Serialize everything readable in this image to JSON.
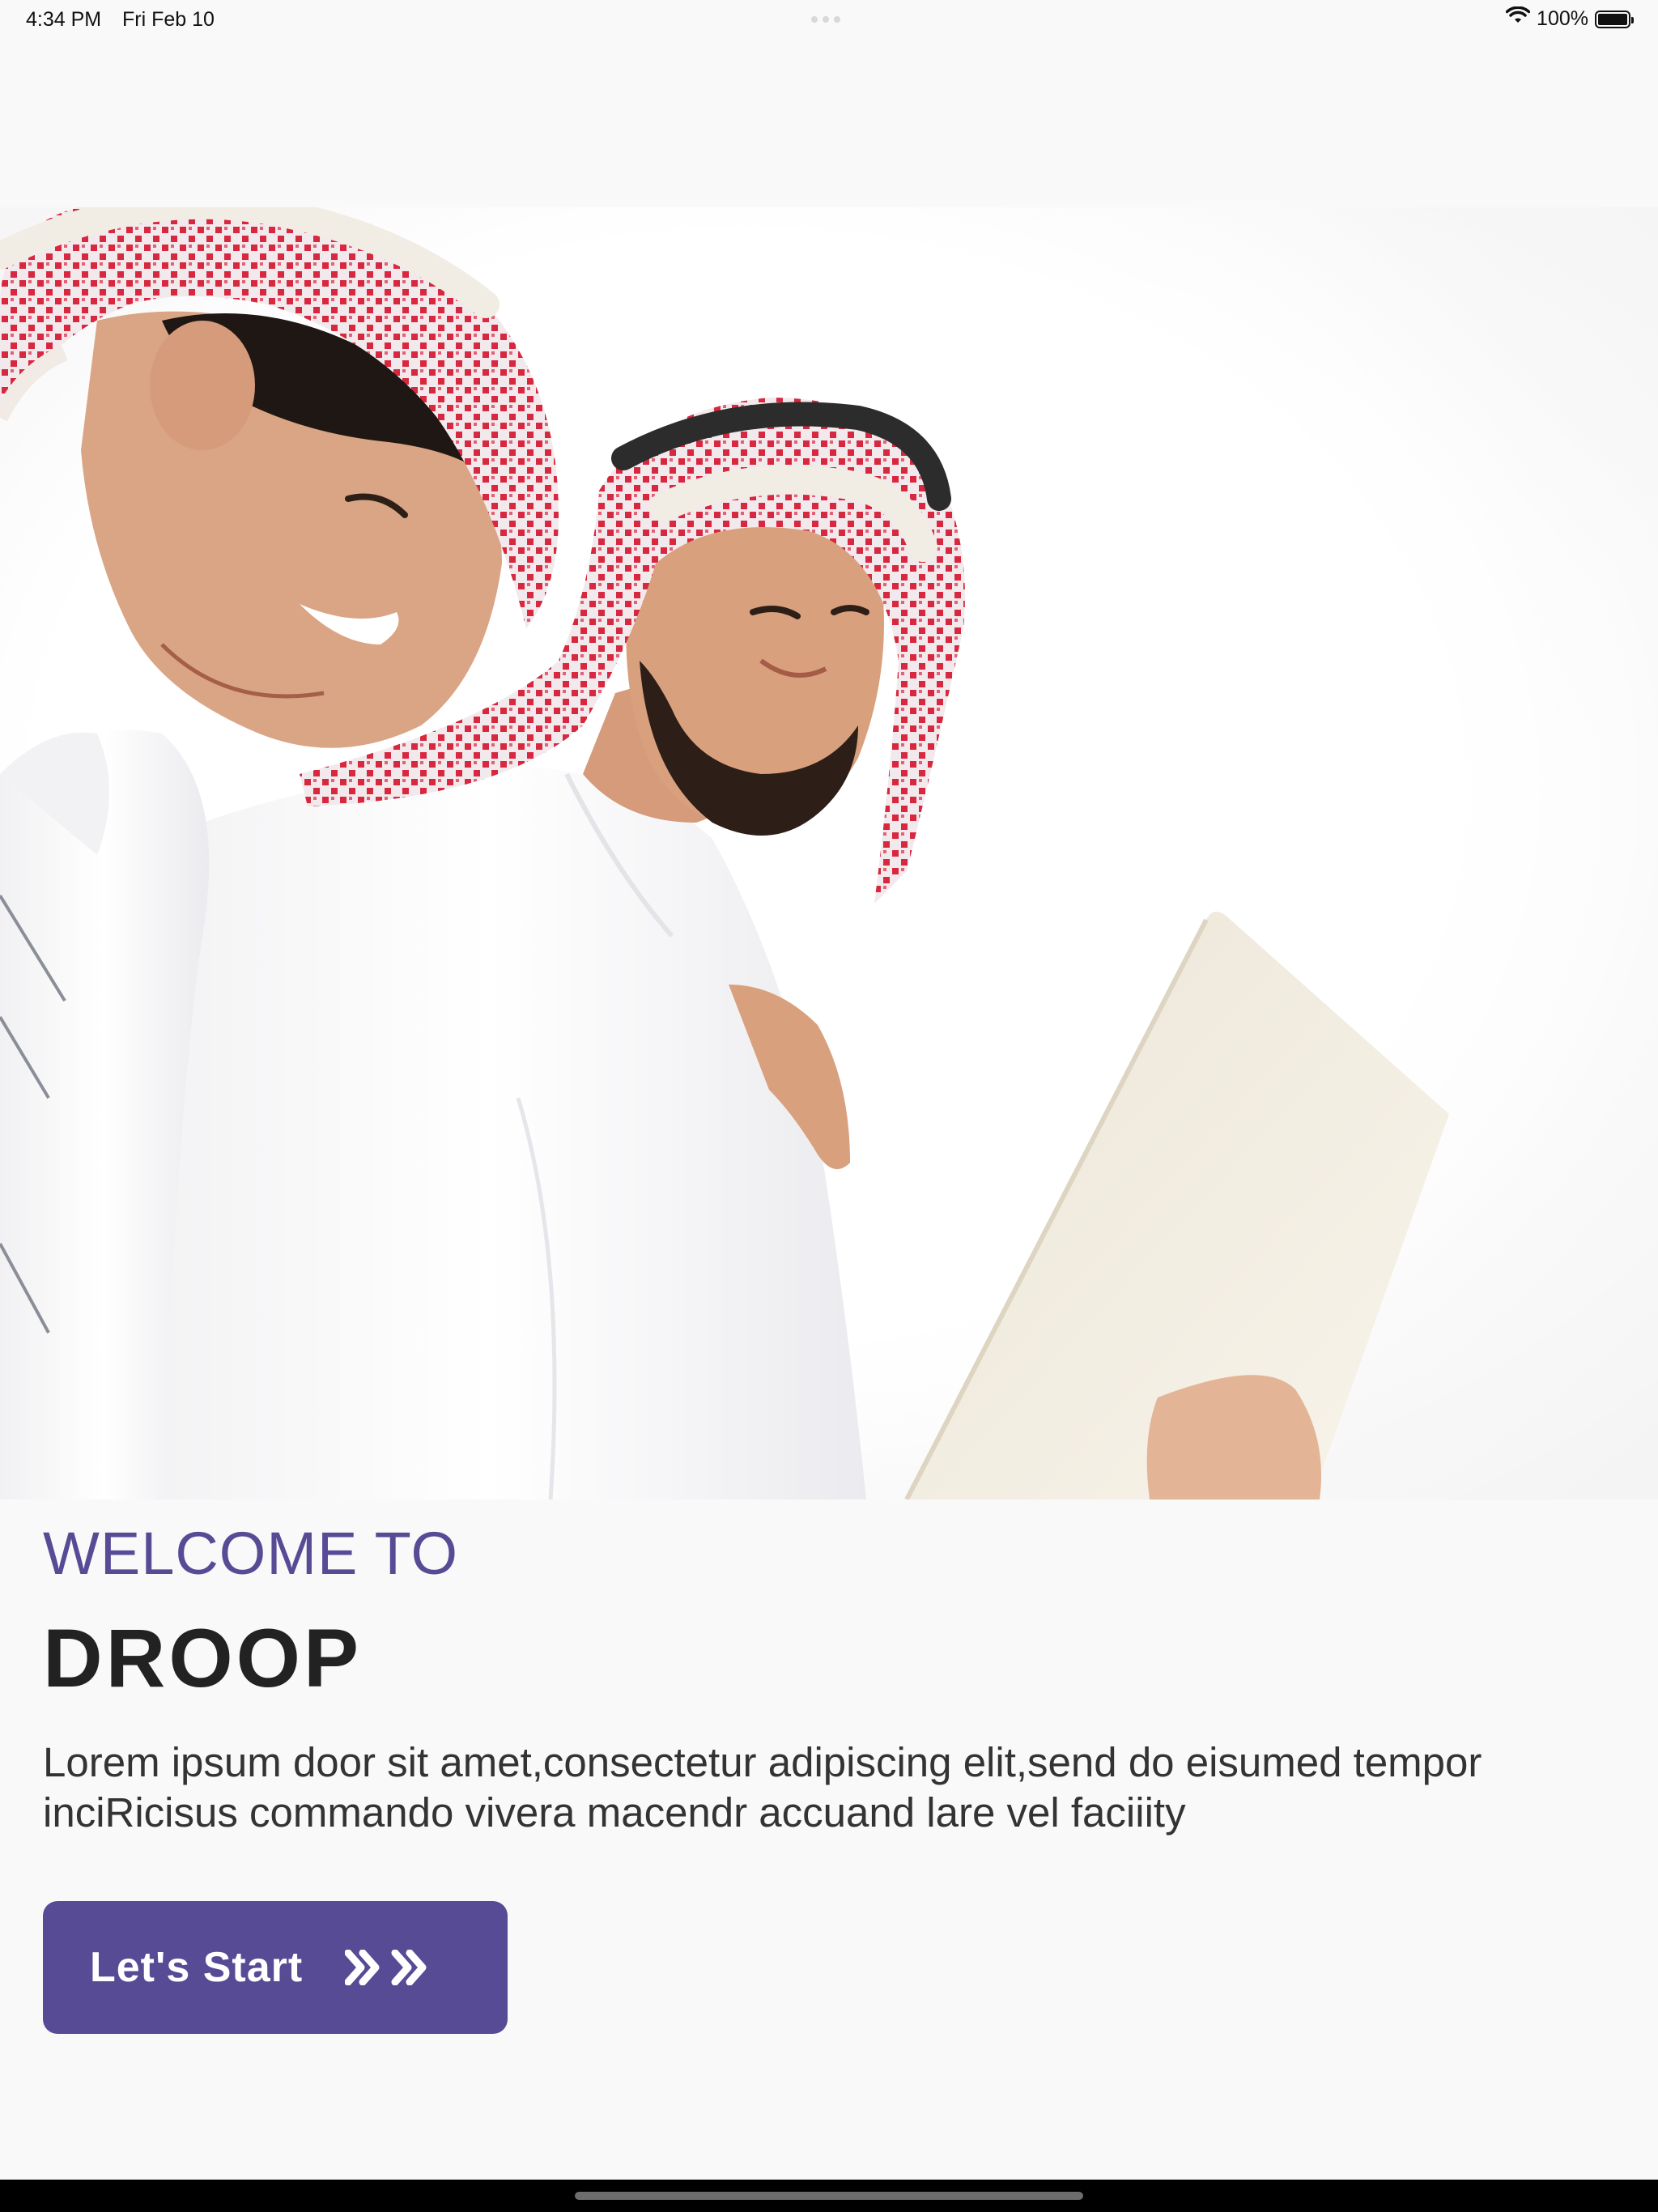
{
  "status_bar": {
    "time": "4:34 PM",
    "date": "Fri Feb 10",
    "battery_percent": "100%",
    "battery_level": 1.0,
    "icons": [
      "wifi-icon",
      "battery-icon"
    ]
  },
  "hero": {
    "image": "hero-photo",
    "description_icon": "photo-two-students-with-laptop"
  },
  "welcome": {
    "label": "WELCOME TO",
    "title": "DROOP",
    "description": "Lorem ipsum door sit amet,consectetur adipiscing elit,send do eisumed tempor inciRicisus commando vivera macendr accuand lare vel faciiity"
  },
  "actions": {
    "start_label": "Let's Start",
    "start_icon": "double-chevron-right-icon"
  },
  "colors": {
    "accent": "#574b96",
    "title": "#222222",
    "body_text": "#333333",
    "background": "#f9f9f9"
  }
}
